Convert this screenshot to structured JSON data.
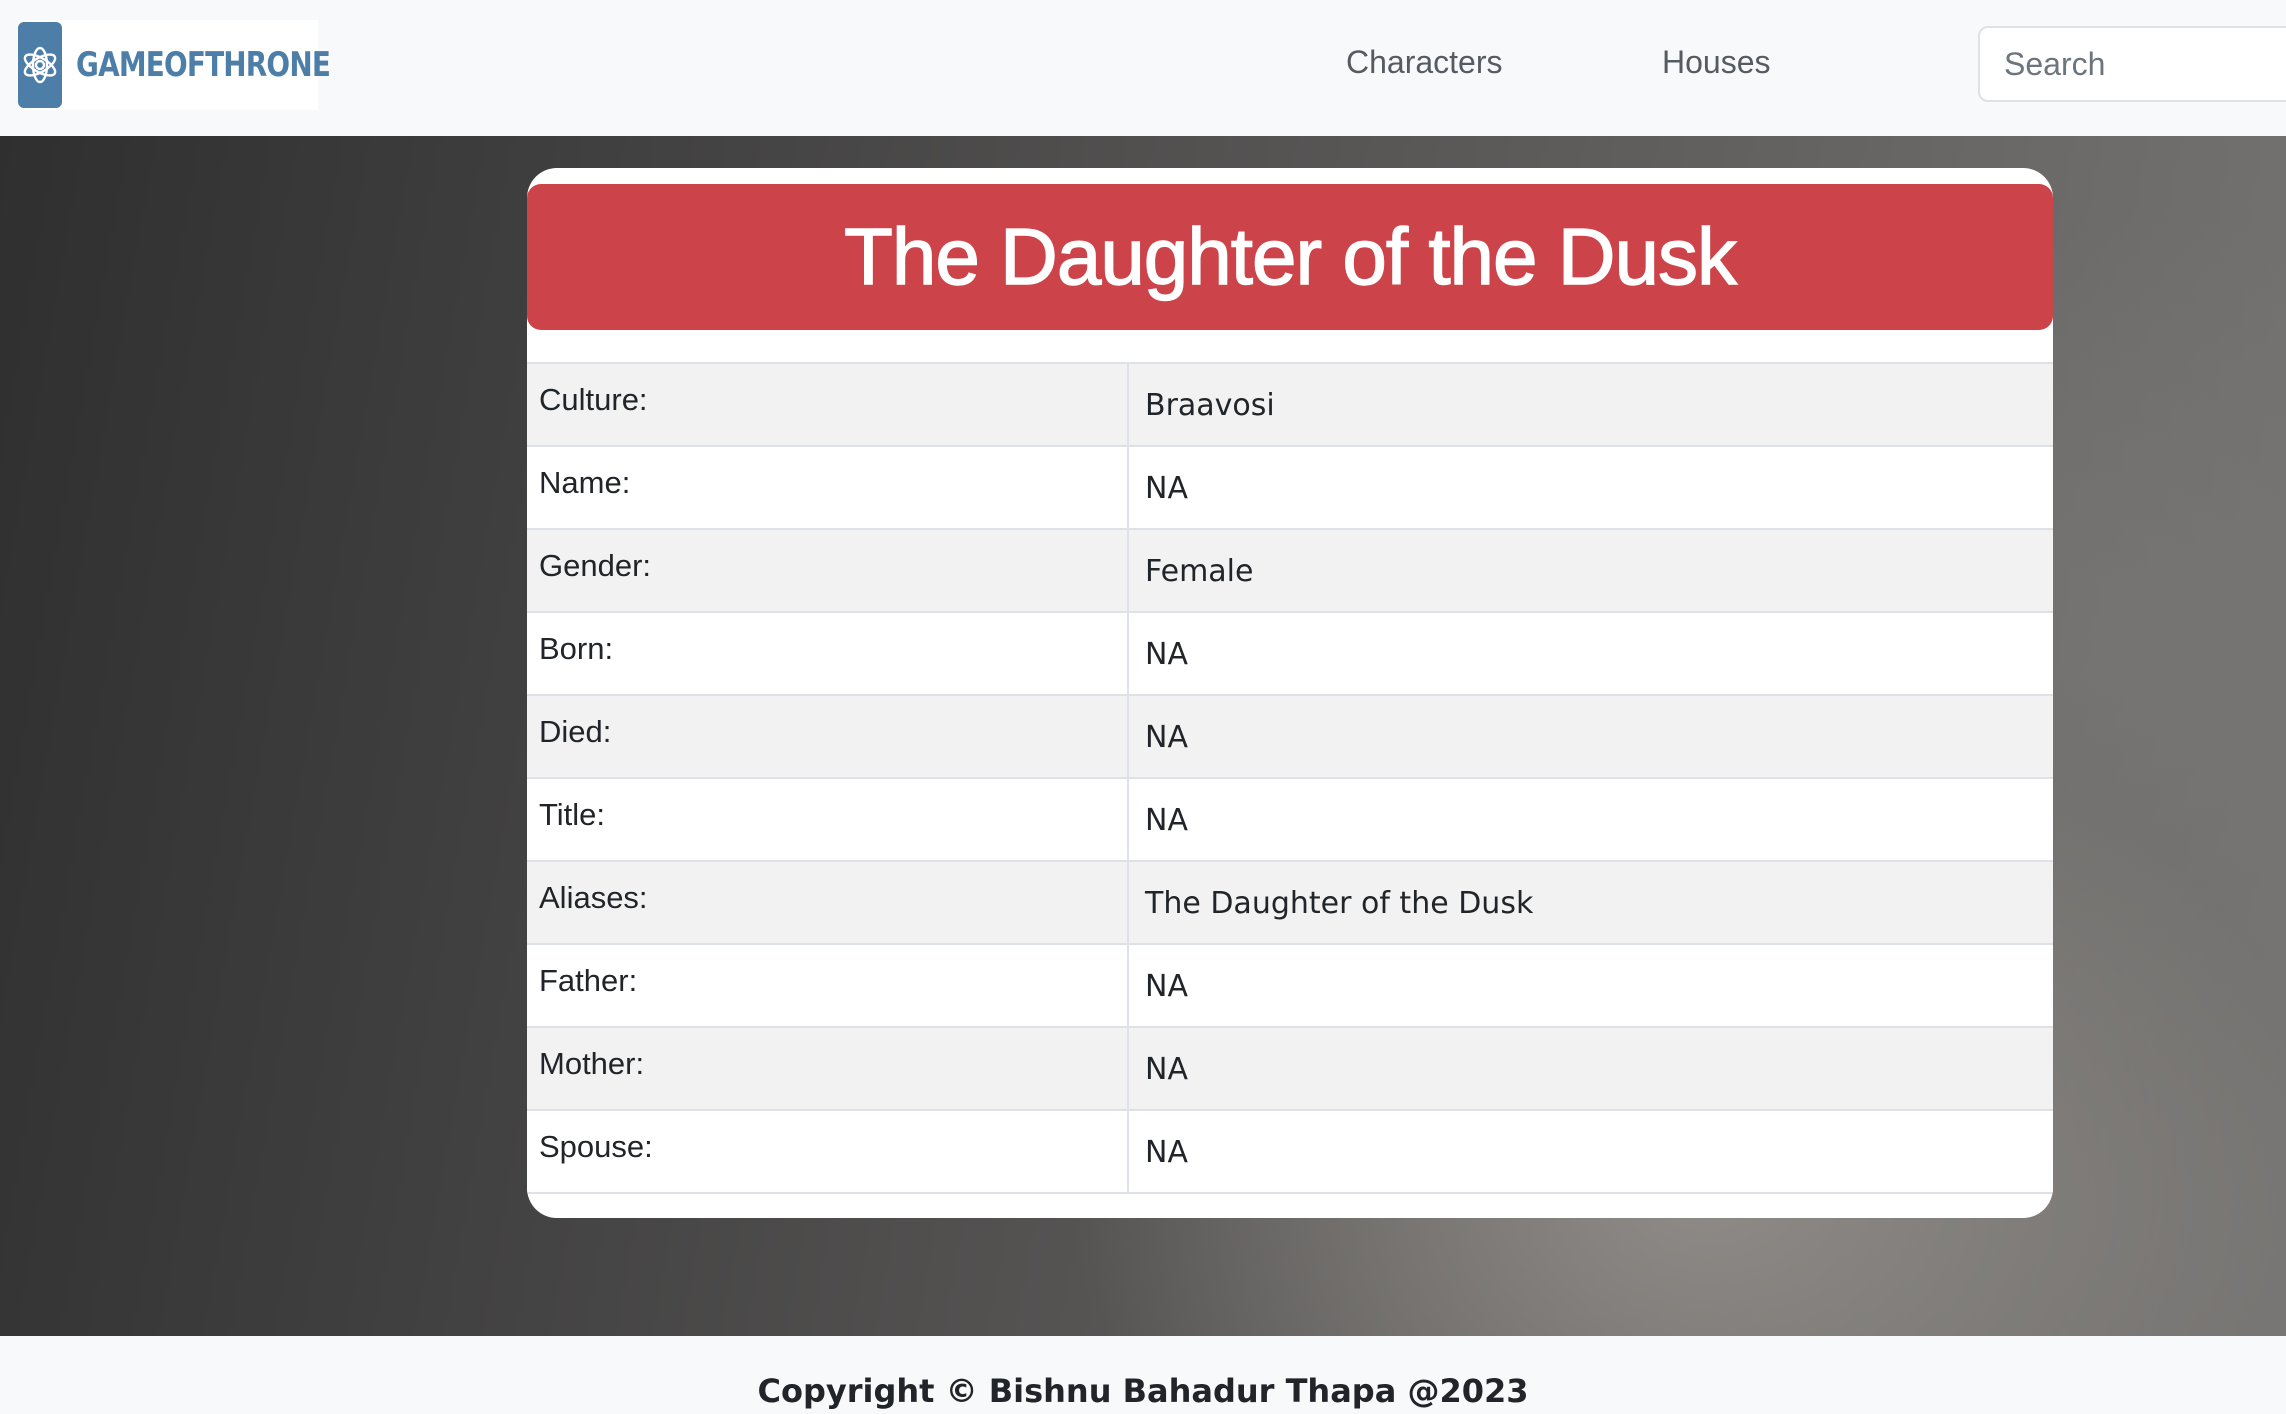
{
  "brand": {
    "name": "GAMEOFTHRONE",
    "icon": "flower-knot-icon",
    "accent_color": "#4d7ea8"
  },
  "nav": {
    "links": [
      {
        "label": "Characters"
      },
      {
        "label": "Houses"
      }
    ],
    "search": {
      "placeholder": "Search",
      "value": ""
    }
  },
  "character": {
    "title": "The Daughter of the Dusk",
    "header_color": "#cc434a",
    "fields": [
      {
        "label": "Culture:",
        "value": "Braavosi"
      },
      {
        "label": "Name:",
        "value": "NA"
      },
      {
        "label": "Gender:",
        "value": "Female"
      },
      {
        "label": "Born:",
        "value": "NA"
      },
      {
        "label": "Died:",
        "value": "NA"
      },
      {
        "label": "Title:",
        "value": "NA"
      },
      {
        "label": "Aliases:",
        "value": "The Daughter of the Dusk"
      },
      {
        "label": "Father:",
        "value": "NA"
      },
      {
        "label": "Mother:",
        "value": "NA"
      },
      {
        "label": "Spouse:",
        "value": "NA"
      }
    ]
  },
  "footer": {
    "copyright": "Copyright © Bishnu Bahadur Thapa @2023"
  }
}
